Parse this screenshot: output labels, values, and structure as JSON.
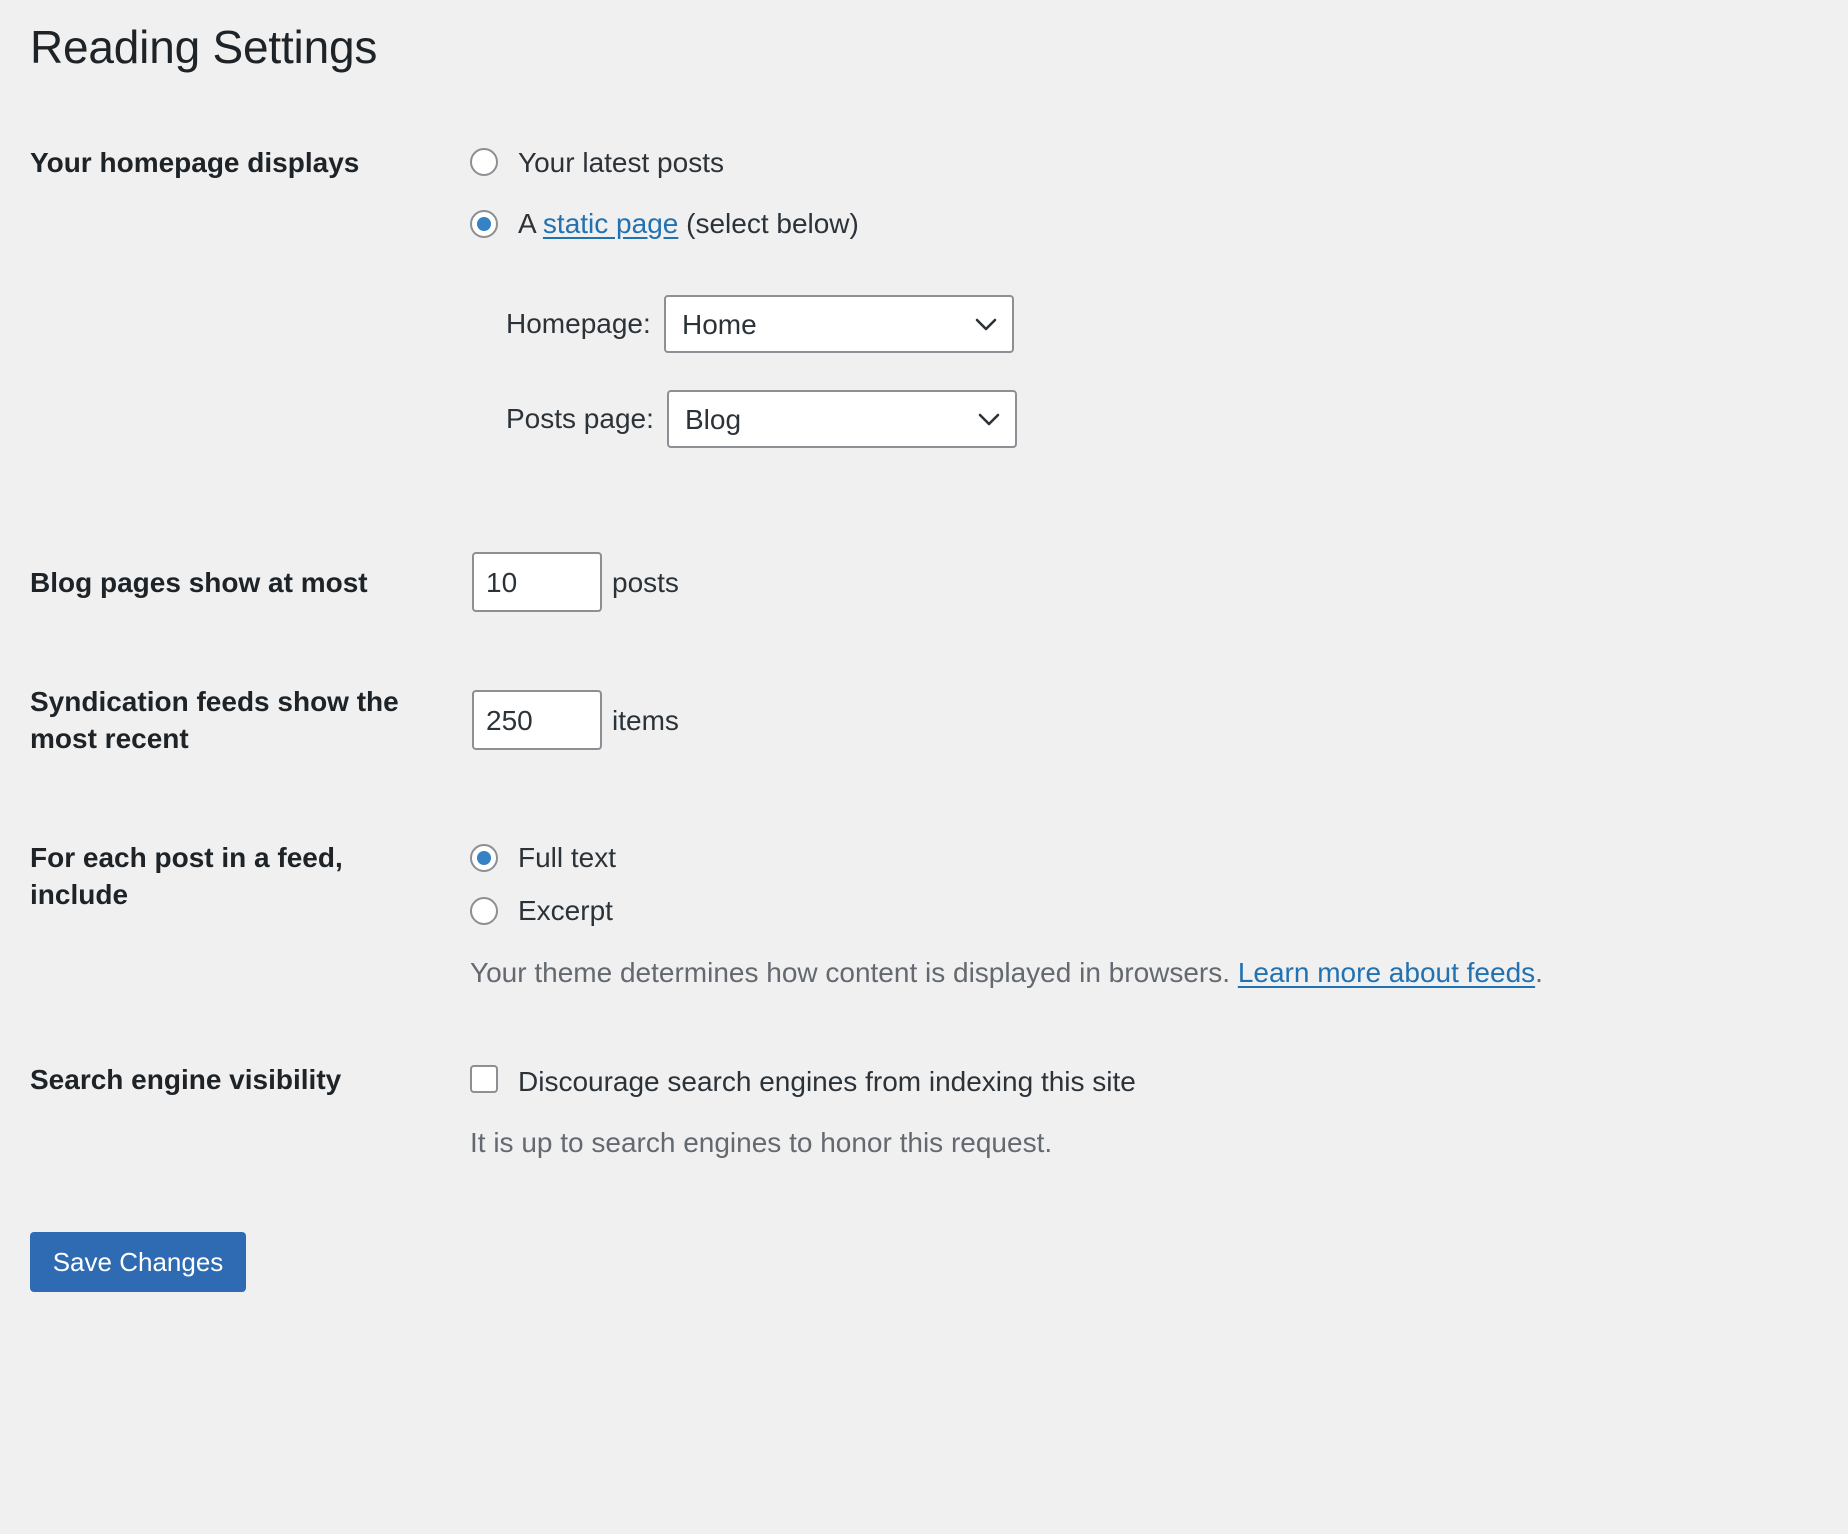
{
  "page": {
    "title": "Reading Settings"
  },
  "homepage_displays": {
    "label": "Your homepage displays",
    "option_latest": "Your latest posts",
    "option_static_prefix": "A",
    "option_static_link": "static page",
    "option_static_suffix": "(select below)",
    "selected": "static",
    "homepage_label": "Homepage:",
    "homepage_value": "Home",
    "posts_page_label": "Posts page:",
    "posts_page_value": "Blog"
  },
  "blog_pages": {
    "label": "Blog pages show at most",
    "value": "10",
    "unit": "posts"
  },
  "syndication": {
    "label": "Syndication feeds show the most recent",
    "value": "250",
    "unit": "items"
  },
  "feed_include": {
    "label": "For each post in a feed, include",
    "option_full": "Full text",
    "option_excerpt": "Excerpt",
    "selected": "full",
    "description": "Your theme determines how content is displayed in browsers.",
    "link": "Learn more about feeds",
    "period": "."
  },
  "search_visibility": {
    "label": "Search engine visibility",
    "checkbox_label": "Discourage search engines from indexing this site",
    "checked": false,
    "description": "It is up to search engines to honor this request."
  },
  "save_button": {
    "label": "Save Changes",
    "color": "#2e6bb2"
  },
  "colors": {
    "background": "#f0f0f1",
    "link": "#2271b1",
    "radio_checked": "#3582c4"
  }
}
